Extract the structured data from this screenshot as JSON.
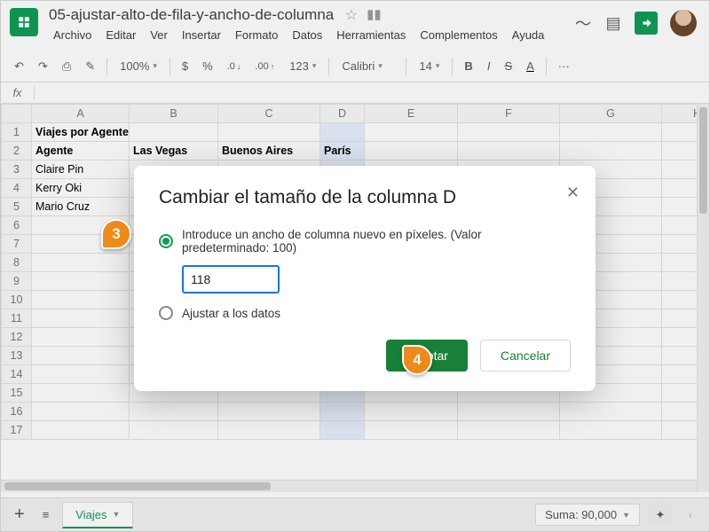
{
  "doc": {
    "name": "05-ajustar-alto-de-fila-y-ancho-de-columna"
  },
  "menu": {
    "file": "Archivo",
    "edit": "Editar",
    "view": "Ver",
    "insert": "Insertar",
    "format": "Formato",
    "data": "Datos",
    "tools": "Herramientas",
    "addons": "Complementos",
    "help": "Ayuda"
  },
  "toolbar": {
    "zoom": "100%",
    "font": "Calibri",
    "size": "14",
    "currency": "$",
    "percent": "%",
    "dec_dec": ".0",
    "dec_inc": ".00",
    "numfmt": "123",
    "bold": "B",
    "italic": "I",
    "strike": "S",
    "textcolor": "A",
    "more": "···"
  },
  "fx": {
    "label": "fx"
  },
  "columns": [
    "",
    "A",
    "B",
    "C",
    "D",
    "E",
    "F",
    "G",
    "H"
  ],
  "rows": [
    {
      "n": "1",
      "cells": [
        "Viajes por Agente y Ciudad",
        "",
        "",
        "",
        "",
        "",
        "",
        ""
      ],
      "bold": true
    },
    {
      "n": "2",
      "cells": [
        "Agente",
        "Las Vegas",
        "Buenos Aires",
        "París",
        "",
        "",
        "",
        ""
      ],
      "bold": true
    },
    {
      "n": "3",
      "cells": [
        "Claire Pin",
        "",
        "",
        "",
        "",
        "",
        "",
        ""
      ]
    },
    {
      "n": "4",
      "cells": [
        "Kerry Oki",
        "",
        "",
        "",
        "",
        "",
        "",
        ""
      ]
    },
    {
      "n": "5",
      "cells": [
        "Mario Cruz",
        "",
        "",
        "",
        "",
        "",
        "",
        ""
      ]
    },
    {
      "n": "6",
      "cells": [
        "",
        "",
        "",
        "",
        "",
        "",
        "",
        ""
      ]
    },
    {
      "n": "7",
      "cells": [
        "",
        "",
        "",
        "",
        "",
        "",
        "",
        ""
      ]
    },
    {
      "n": "8",
      "cells": [
        "",
        "",
        "",
        "",
        "",
        "",
        "",
        ""
      ]
    },
    {
      "n": "9",
      "cells": [
        "",
        "",
        "",
        "",
        "",
        "",
        "",
        ""
      ]
    },
    {
      "n": "10",
      "cells": [
        "",
        "",
        "",
        "",
        "",
        "",
        "",
        ""
      ]
    },
    {
      "n": "11",
      "cells": [
        "",
        "",
        "",
        "",
        "",
        "",
        "",
        ""
      ]
    },
    {
      "n": "12",
      "cells": [
        "",
        "",
        "",
        "",
        "",
        "",
        "",
        ""
      ]
    },
    {
      "n": "13",
      "cells": [
        "",
        "",
        "",
        "",
        "",
        "",
        "",
        ""
      ]
    },
    {
      "n": "14",
      "cells": [
        "",
        "",
        "",
        "",
        "",
        "",
        "",
        ""
      ]
    },
    {
      "n": "15",
      "cells": [
        "",
        "",
        "",
        "",
        "",
        "",
        "",
        ""
      ]
    },
    {
      "n": "16",
      "cells": [
        "",
        "",
        "",
        "",
        "",
        "",
        "",
        ""
      ]
    },
    {
      "n": "17",
      "cells": [
        "",
        "",
        "",
        "",
        "",
        "",
        "",
        ""
      ]
    }
  ],
  "selected_col_index": 4,
  "dialog": {
    "title": "Cambiar el tamaño de la columna D",
    "opt1": "Introduce un ancho de columna nuevo en píxeles. (Valor predeterminado: 100)",
    "value": "118",
    "opt2": "Ajustar a los datos",
    "ok": "Aceptar",
    "cancel": "Cancelar"
  },
  "sheetbar": {
    "tab": "Viajes",
    "sum": "Suma: 90,000"
  },
  "callouts": {
    "c3": "3",
    "c4": "4"
  }
}
